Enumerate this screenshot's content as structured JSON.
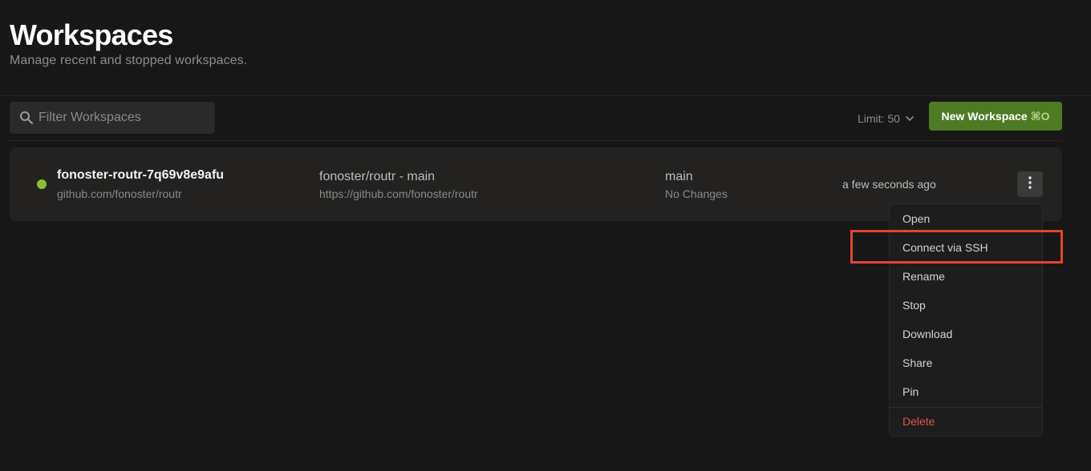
{
  "header": {
    "title": "Workspaces",
    "subtitle": "Manage recent and stopped workspaces."
  },
  "toolbar": {
    "search_placeholder": "Filter Workspaces",
    "search_value": "",
    "limit_label": "Limit: 50",
    "new_workspace_label": "New Workspace",
    "new_workspace_shortcut": "⌘O"
  },
  "workspace": {
    "status": "running",
    "status_color": "#8bc034",
    "name": "fonoster-routr-7q69v8e9afu",
    "source": "github.com/fonoster/routr",
    "repo_title": "fonoster/routr - main",
    "repo_url": "https://github.com/fonoster/routr",
    "branch": "main",
    "changes": "No Changes",
    "last_active": "a few seconds ago"
  },
  "menu": {
    "items": [
      {
        "label": "Open"
      },
      {
        "label": "Connect via SSH",
        "highlighted": true
      },
      {
        "label": "Rename"
      },
      {
        "label": "Stop"
      },
      {
        "label": "Download"
      },
      {
        "label": "Share"
      },
      {
        "label": "Pin"
      },
      {
        "label": "Delete",
        "danger": true
      }
    ]
  },
  "colors": {
    "accent": "#4e7a24",
    "danger": "#e5534b",
    "highlight": "#e2462c"
  },
  "icons": {
    "search": "search-icon",
    "limit_chevron": "chevron-down-icon",
    "row_menu": "more-vertical-icon"
  }
}
